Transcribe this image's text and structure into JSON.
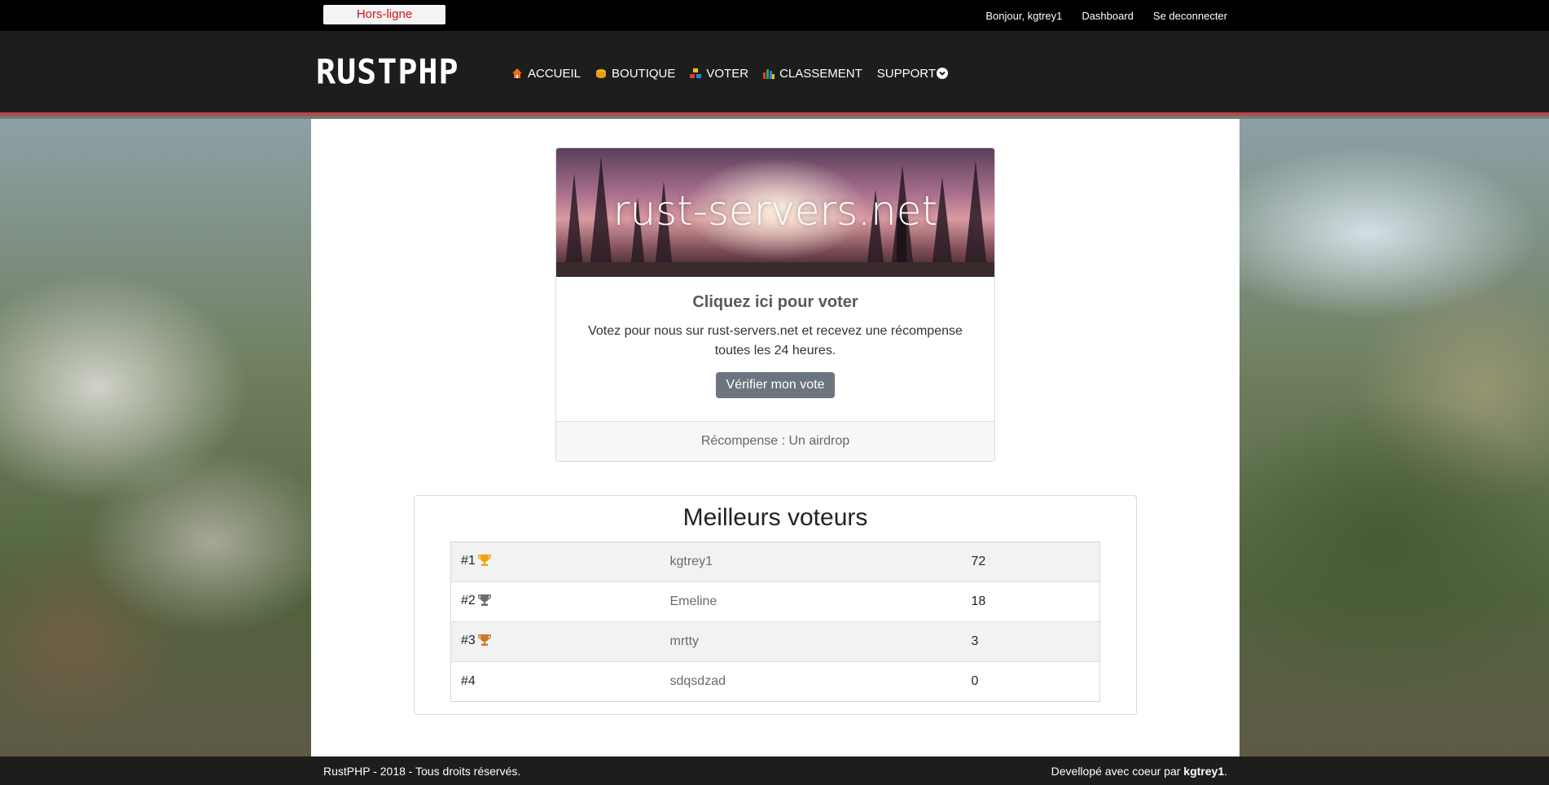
{
  "topbar": {
    "status": "Hors-ligne",
    "greeting": "Bonjour, kgtrey1",
    "dashboard": "Dashboard",
    "logout": "Se deconnecter"
  },
  "brand": {
    "logo": "RUSTPHP"
  },
  "nav": {
    "items": [
      {
        "label": "ACCUEIL",
        "icon": "home-icon"
      },
      {
        "label": "BOUTIQUE",
        "icon": "coins-icon"
      },
      {
        "label": "VOTER",
        "icon": "vote-boxes-icon"
      },
      {
        "label": "CLASSEMENT",
        "icon": "bar-chart-icon"
      },
      {
        "label": "SUPPORT",
        "icon": "chevron-down-circle-icon"
      }
    ]
  },
  "vote_card": {
    "banner_text": "rust-servers.net",
    "title": "Cliquez ici pour voter",
    "text": "Votez pour nous sur rust-servers.net et recevez une récompense toutes les 24 heures.",
    "button": "Vérifier mon vote",
    "reward": "Récompense : Un airdrop"
  },
  "voters": {
    "title": "Meilleurs voteurs",
    "rows": [
      {
        "rank": "#1",
        "trophy": "gold",
        "name": "kgtrey1",
        "votes": "72"
      },
      {
        "rank": "#2",
        "trophy": "silver",
        "name": "Emeline",
        "votes": "18"
      },
      {
        "rank": "#3",
        "trophy": "bronze",
        "name": "mrtty",
        "votes": "3"
      },
      {
        "rank": "#4",
        "trophy": "",
        "name": "sdqsdzad",
        "votes": "0"
      }
    ]
  },
  "footer": {
    "left": "RustPHP - 2018 - Tous droits réservés.",
    "right_prefix": "Devellopé avec coeur par ",
    "right_author": "kgtrey1",
    "right_suffix": "."
  },
  "colors": {
    "status_text": "#d6111a",
    "nav_border": "#b9464a",
    "trophy_gold": "#f1a410",
    "trophy_silver": "#6b6b6b",
    "trophy_bronze": "#cc7a2a"
  }
}
